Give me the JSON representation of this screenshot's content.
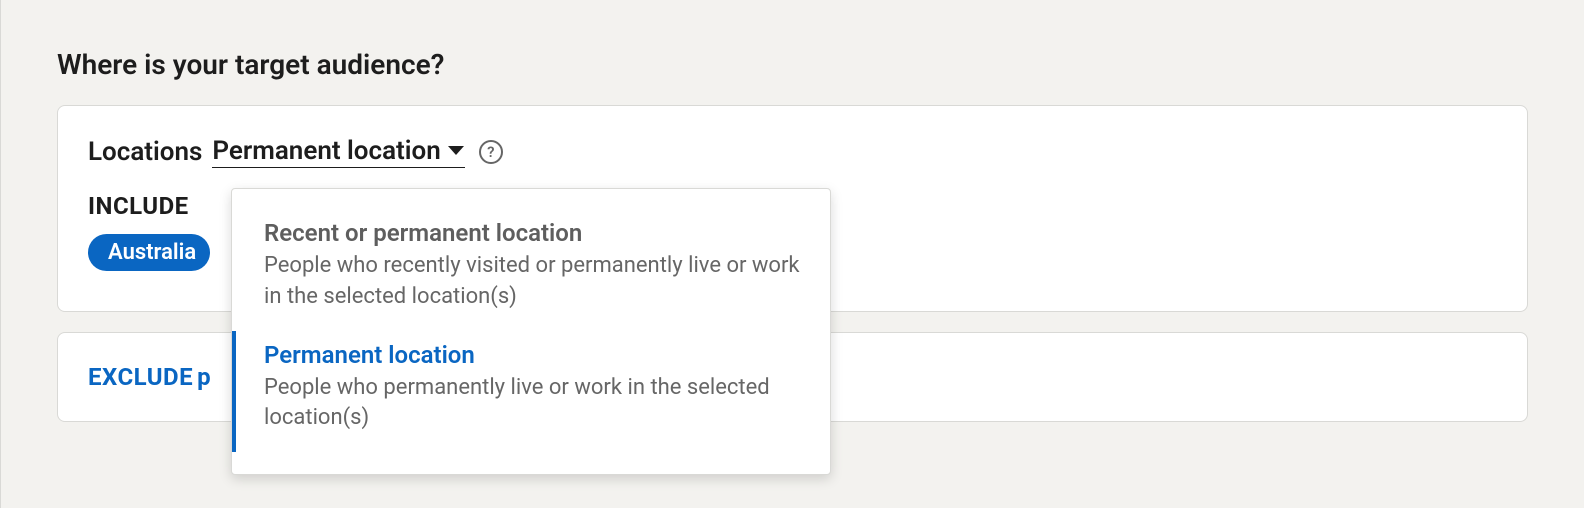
{
  "section": {
    "title": "Where is your target audience?"
  },
  "locations": {
    "label": "Locations",
    "dropdown_selected": "Permanent location",
    "include_label": "INCLUDE",
    "exclude_label": "EXCLUDE",
    "exclude_trailing": "p",
    "pills": [
      {
        "label": "Australia"
      }
    ]
  },
  "dropdown": {
    "options": [
      {
        "title": "Recent or permanent location",
        "desc": "People who recently visited or permanently live or work in the selected location(s)",
        "selected": false
      },
      {
        "title": "Permanent location",
        "desc": "People who permanently live or work in the selected location(s)",
        "selected": true
      }
    ]
  },
  "icons": {
    "help": "?"
  }
}
